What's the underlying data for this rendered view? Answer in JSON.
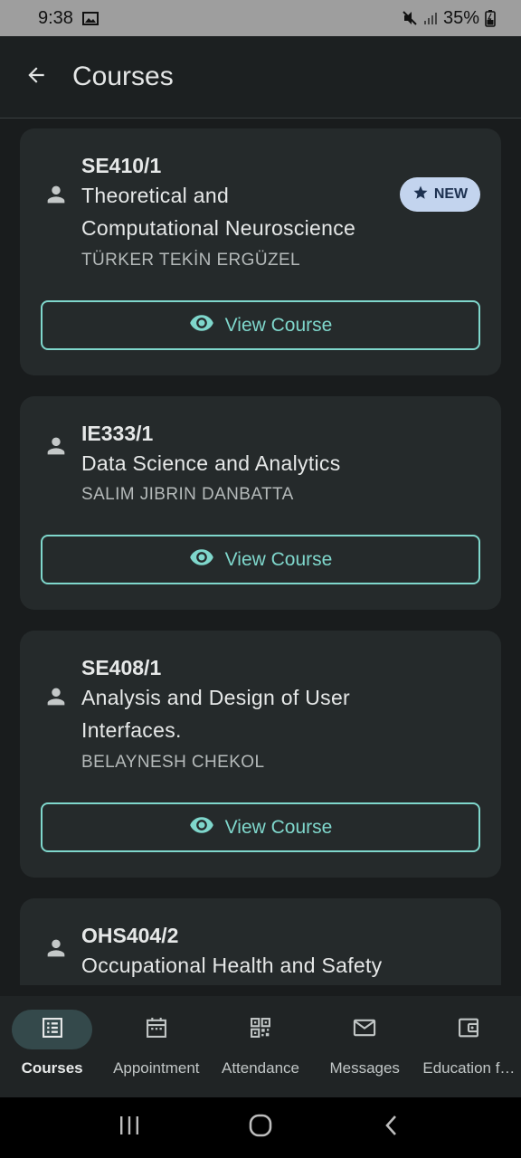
{
  "status_bar": {
    "time": "9:38",
    "battery": "35%"
  },
  "app_bar": {
    "title": "Courses"
  },
  "courses": [
    {
      "code": "SE410/1",
      "title_lines": [
        "Theoretical and",
        "Computational Neuroscience"
      ],
      "instructor": "TÜRKER TEKİN ERGÜZEL",
      "badge": "NEW",
      "button_label": "View Course"
    },
    {
      "code": "IE333/1",
      "title_lines": [
        "Data Science and Analytics"
      ],
      "instructor": "SALIM JIBRIN DANBATTA",
      "button_label": "View Course"
    },
    {
      "code": "SE408/1",
      "title_lines": [
        "Analysis and Design of User",
        "Interfaces."
      ],
      "instructor": "BELAYNESH CHEKOL",
      "button_label": "View Course"
    },
    {
      "code": "OHS404/2",
      "title_lines": [
        "Occupational Health and Safety"
      ]
    }
  ],
  "bottom_nav": {
    "items": [
      {
        "label": "Courses",
        "icon": "list-alt-icon",
        "active": true
      },
      {
        "label": "Appointment",
        "icon": "calendar-icon",
        "active": false
      },
      {
        "label": "Attendance",
        "icon": "qr-code-icon",
        "active": false
      },
      {
        "label": "Messages",
        "icon": "mail-icon",
        "active": false
      },
      {
        "label": "Education f…",
        "icon": "wallet-icon",
        "active": false
      }
    ]
  },
  "colors": {
    "background": "#191c1d",
    "card": "#252a2b",
    "accent": "#7fd7cc",
    "badge_bg": "#c3d4ee",
    "badge_text": "#1d3150"
  }
}
